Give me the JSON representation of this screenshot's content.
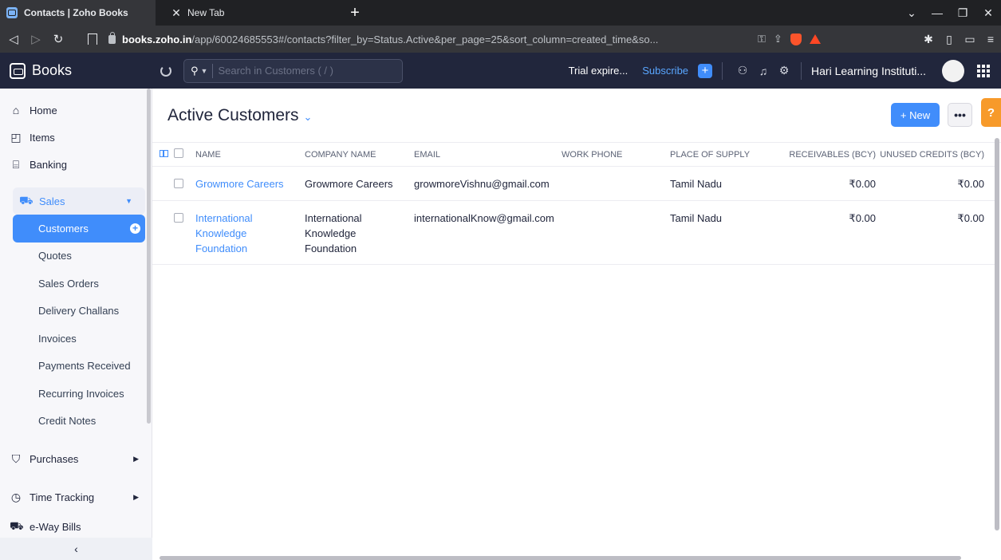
{
  "browser": {
    "tabs": [
      {
        "title": "Contacts | Zoho Books",
        "active": true
      },
      {
        "title": "New Tab",
        "active": false
      }
    ],
    "url_host": "books.zoho.in",
    "url_rest": "/app/60024685553#/contacts?filter_by=Status.Active&per_page=25&sort_column=created_time&so..."
  },
  "header": {
    "brand": "Books",
    "search_placeholder": "Search in Customers ( / )",
    "trial": "Trial expire...",
    "subscribe": "Subscribe",
    "org": "Hari Learning Instituti...",
    "accent": "#408dfb"
  },
  "sidebar": {
    "home": "Home",
    "items": "Items",
    "banking": "Banking",
    "sales": "Sales",
    "sales_sub": [
      "Customers",
      "Quotes",
      "Sales Orders",
      "Delivery Challans",
      "Invoices",
      "Payments Received",
      "Recurring Invoices",
      "Credit Notes"
    ],
    "purchases": "Purchases",
    "time_tracking": "Time Tracking",
    "eway": "e-Way Bills"
  },
  "main": {
    "title": "Active Customers",
    "new_label": "+ New",
    "more_label": "•••",
    "help_label": "?",
    "columns": {
      "name": "NAME",
      "company": "COMPANY NAME",
      "email": "EMAIL",
      "phone": "WORK PHONE",
      "place": "PLACE OF SUPPLY",
      "receivables": "RECEIVABLES (BCY)",
      "unused": "UNUSED CREDITS (BCY)"
    },
    "rows": [
      {
        "name": "Growmore Careers",
        "company": "Growmore Careers",
        "email": "growmoreVishnu@gmail.com",
        "phone": "",
        "place": "Tamil Nadu",
        "receivables": "₹0.00",
        "unused": "₹0.00"
      },
      {
        "name": "International Knowledge Foundation",
        "company": "International Knowledge Foundation",
        "email": "internationalKnow@gmail.com",
        "phone": "",
        "place": "Tamil Nadu",
        "receivables": "₹0.00",
        "unused": "₹0.00"
      }
    ]
  }
}
